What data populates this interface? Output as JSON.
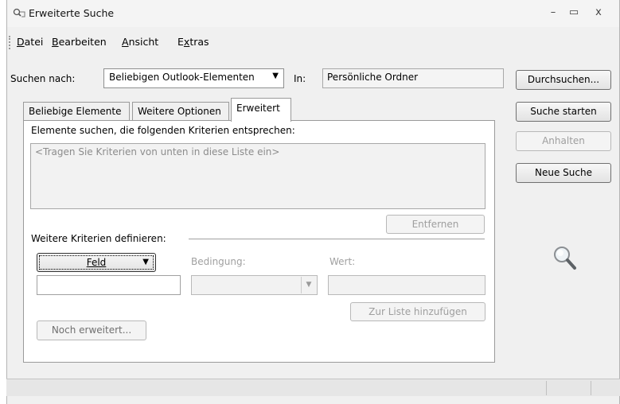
{
  "window": {
    "title": "Erweiterte Suche",
    "icon": "search-folder-icon",
    "minimize_glyph": "–",
    "maximize_glyph": "▭",
    "close_glyph": "x"
  },
  "menu": [
    {
      "label": "Datei",
      "mnemonic": "D"
    },
    {
      "label": "Bearbeiten",
      "mnemonic": "B"
    },
    {
      "label": "Ansicht",
      "mnemonic": "A"
    },
    {
      "label": "Extras",
      "mnemonic": "x"
    }
  ],
  "search": {
    "search_for_label": "Suchen nach:",
    "search_for_value": "Beliebigen Outlook-Elementen",
    "in_label": "In:",
    "in_value": "Persönliche Ordner"
  },
  "tabs": [
    {
      "label": "Beliebige Elemente",
      "active": false
    },
    {
      "label": "Weitere Optionen",
      "active": false
    },
    {
      "label": "Erweitert",
      "active": true
    }
  ],
  "advanced": {
    "criteria_heading": "Elemente suchen, die folgenden Kriterien entsprechen:",
    "criteria_placeholder": "<Tragen Sie Kriterien von unten in diese Liste ein>",
    "remove_button": "Entfernen",
    "define_heading": "Weitere Kriterien definieren:",
    "field_button": "Feld",
    "condition_label": "Bedingung:",
    "value_label": "Wert:",
    "add_to_list_button": "Zur Liste hinzufügen",
    "more_advanced_button": "Noch erweitert..."
  },
  "side_buttons": {
    "browse": "Durchsuchen...",
    "start_search": "Suche starten",
    "stop": "Anhalten",
    "new_search": "Neue Suche"
  }
}
